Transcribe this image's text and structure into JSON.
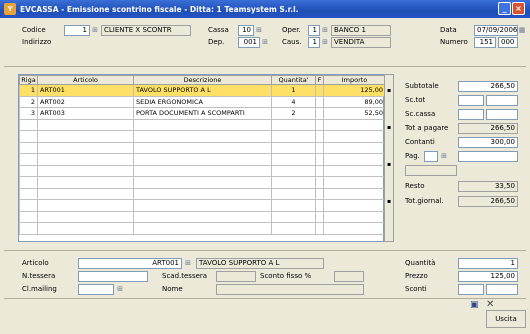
{
  "window": {
    "title": "EVCASSA - Emissione scontrino fiscale - Ditta: 1 Teamsystem S.r.l."
  },
  "header": {
    "codice_label": "Codice",
    "codice_value": "1",
    "cliente_value": "CLIENTE X SCONTR",
    "indirizzo_label": "Indirizzo",
    "cassa_label": "Cassa",
    "cassa_value": "10",
    "dep_label": "Dep.",
    "dep_value": "001",
    "oper_label": "Oper.",
    "oper_value": "1",
    "oper_desc": "BANCO 1",
    "caus_label": "Caus.",
    "caus_value": "1",
    "caus_desc": "VENDITA",
    "data_label": "Data",
    "data_value": "07/09/2006",
    "numero_label": "Numero",
    "numero_value": "151",
    "numero_suffix": "000"
  },
  "grid": {
    "columns": [
      "Riga",
      "Articolo",
      "Descrizione",
      "Quantita'",
      "F",
      "Importo"
    ],
    "rows": [
      {
        "riga": "1",
        "articolo": "ART001",
        "descrizione": "TAVOLO SUPPORTO A L",
        "quantita": "1",
        "f": "",
        "importo": "125,00"
      },
      {
        "riga": "2",
        "articolo": "ART002",
        "descrizione": "SEDIA ERGONOMICA",
        "quantita": "4",
        "f": "",
        "importo": "89,00"
      },
      {
        "riga": "3",
        "articolo": "ART003",
        "descrizione": "PORTA DOCUMENTI A SCOMPARTI",
        "quantita": "2",
        "f": "",
        "importo": "52,50"
      }
    ]
  },
  "totals": {
    "subtotale_label": "Subtotale",
    "subtotale_value": "266,50",
    "sc_tot_label": "Sc.tot",
    "sc_cassa_label": "Sc.cassa",
    "tot_pagare_label": "Tot a pagare",
    "tot_pagare_value": "266,50",
    "contanti_label": "Contanti",
    "contanti_value": "300,00",
    "pag_label": "Pag.",
    "resto_label": "Resto",
    "resto_value": "33,50",
    "tot_giornal_label": "Tot.giornal.",
    "tot_giornal_value": "266,50"
  },
  "detail": {
    "articolo_label": "Articolo",
    "articolo_value": "ART001",
    "articolo_desc": "TAVOLO SUPPORTO A L",
    "ntessera_label": "N.tessera",
    "scad_tessera_label": "Scad.tessera",
    "sconto_fisso_label": "Sconto fisso %",
    "clmailing_label": "Cl.mailing",
    "nome_label": "Nome",
    "quantita_label": "Quantità",
    "quantita_value": "1",
    "prezzo_label": "Prezzo",
    "prezzo_value": "125,00",
    "sconti_label": "Sconti"
  },
  "footer": {
    "uscita_label": "Uscita"
  }
}
